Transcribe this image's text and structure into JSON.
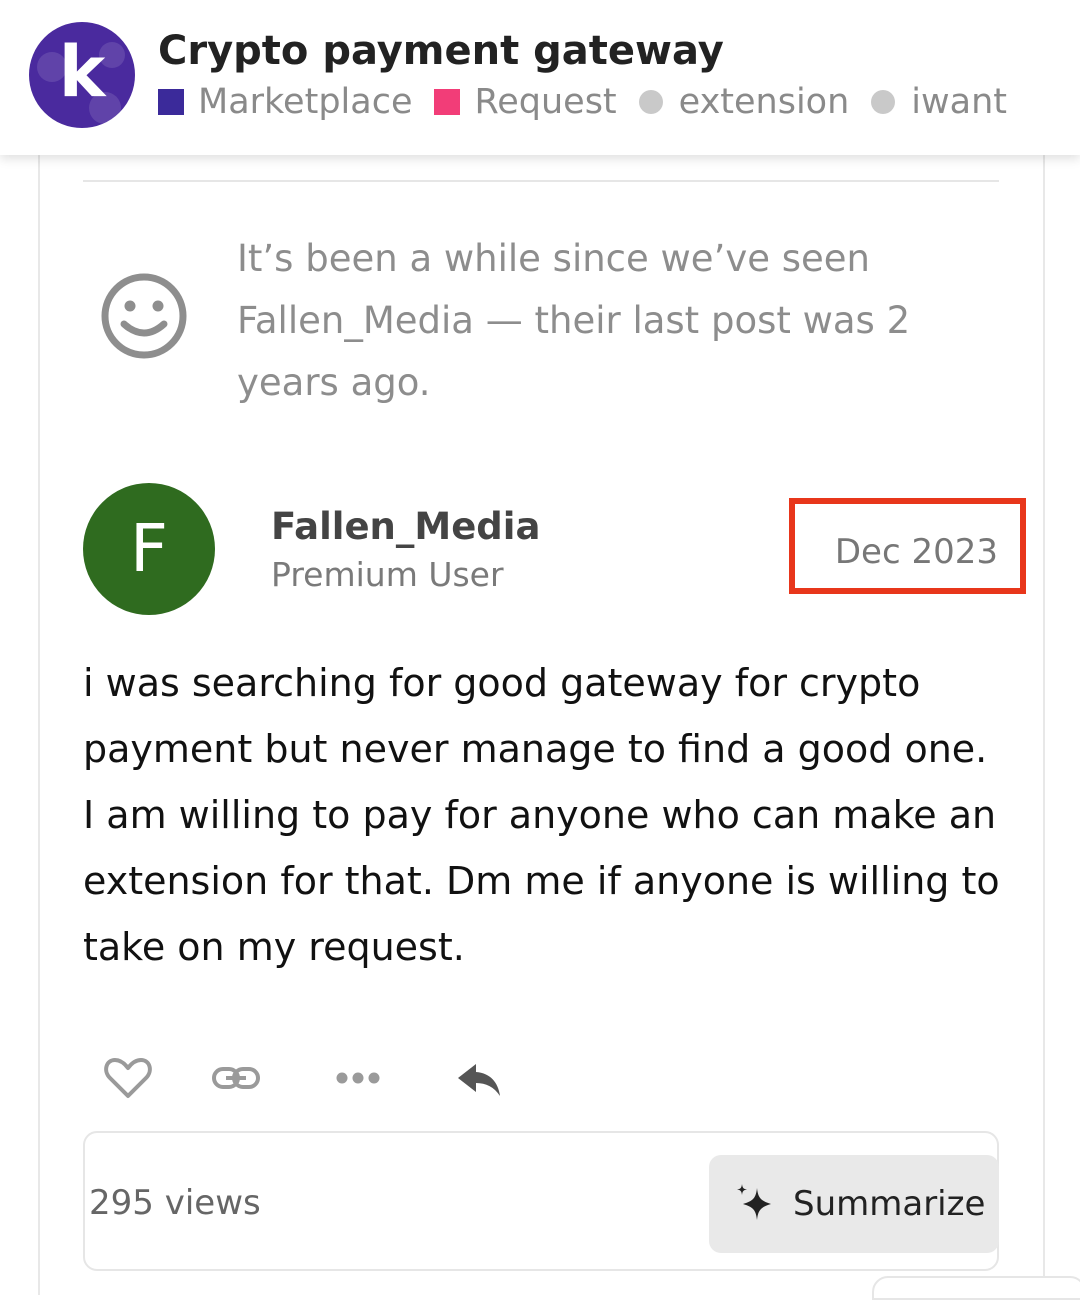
{
  "topic": {
    "title": "Crypto payment gateway",
    "logo_letter": "k",
    "tags": [
      {
        "label": "Marketplace",
        "shape": "square",
        "color": "#3b2a9a"
      },
      {
        "label": "Request",
        "shape": "square",
        "color": "#f23d78"
      },
      {
        "label": "extension",
        "shape": "dot",
        "color": "#c9c9c9"
      },
      {
        "label": "iwant",
        "shape": "dot",
        "color": "#c9c9c9"
      }
    ]
  },
  "notice": {
    "icon": "smile-icon",
    "text": "It’s been a while since we’ve seen Fallen_Media — their last post was 2 years ago."
  },
  "post": {
    "avatar_letter": "F",
    "avatar_color": "#2f6b1f",
    "username": "Fallen_Media",
    "user_title": "Premium User",
    "date": "Dec 2023",
    "highlight_color": "#e8361b",
    "body": "i was searching for good gateway for crypto payment but never manage to find a good one. I am willing to pay for anyone who can make an extension for that. Dm me if anyone is willing to take on my request."
  },
  "actions": [
    "heart-icon",
    "link-icon",
    "more-icon",
    "reply-icon"
  ],
  "footer": {
    "views": "295 views",
    "summarize_label": "Summarize",
    "summarize_icon": "sparkle-icon"
  }
}
